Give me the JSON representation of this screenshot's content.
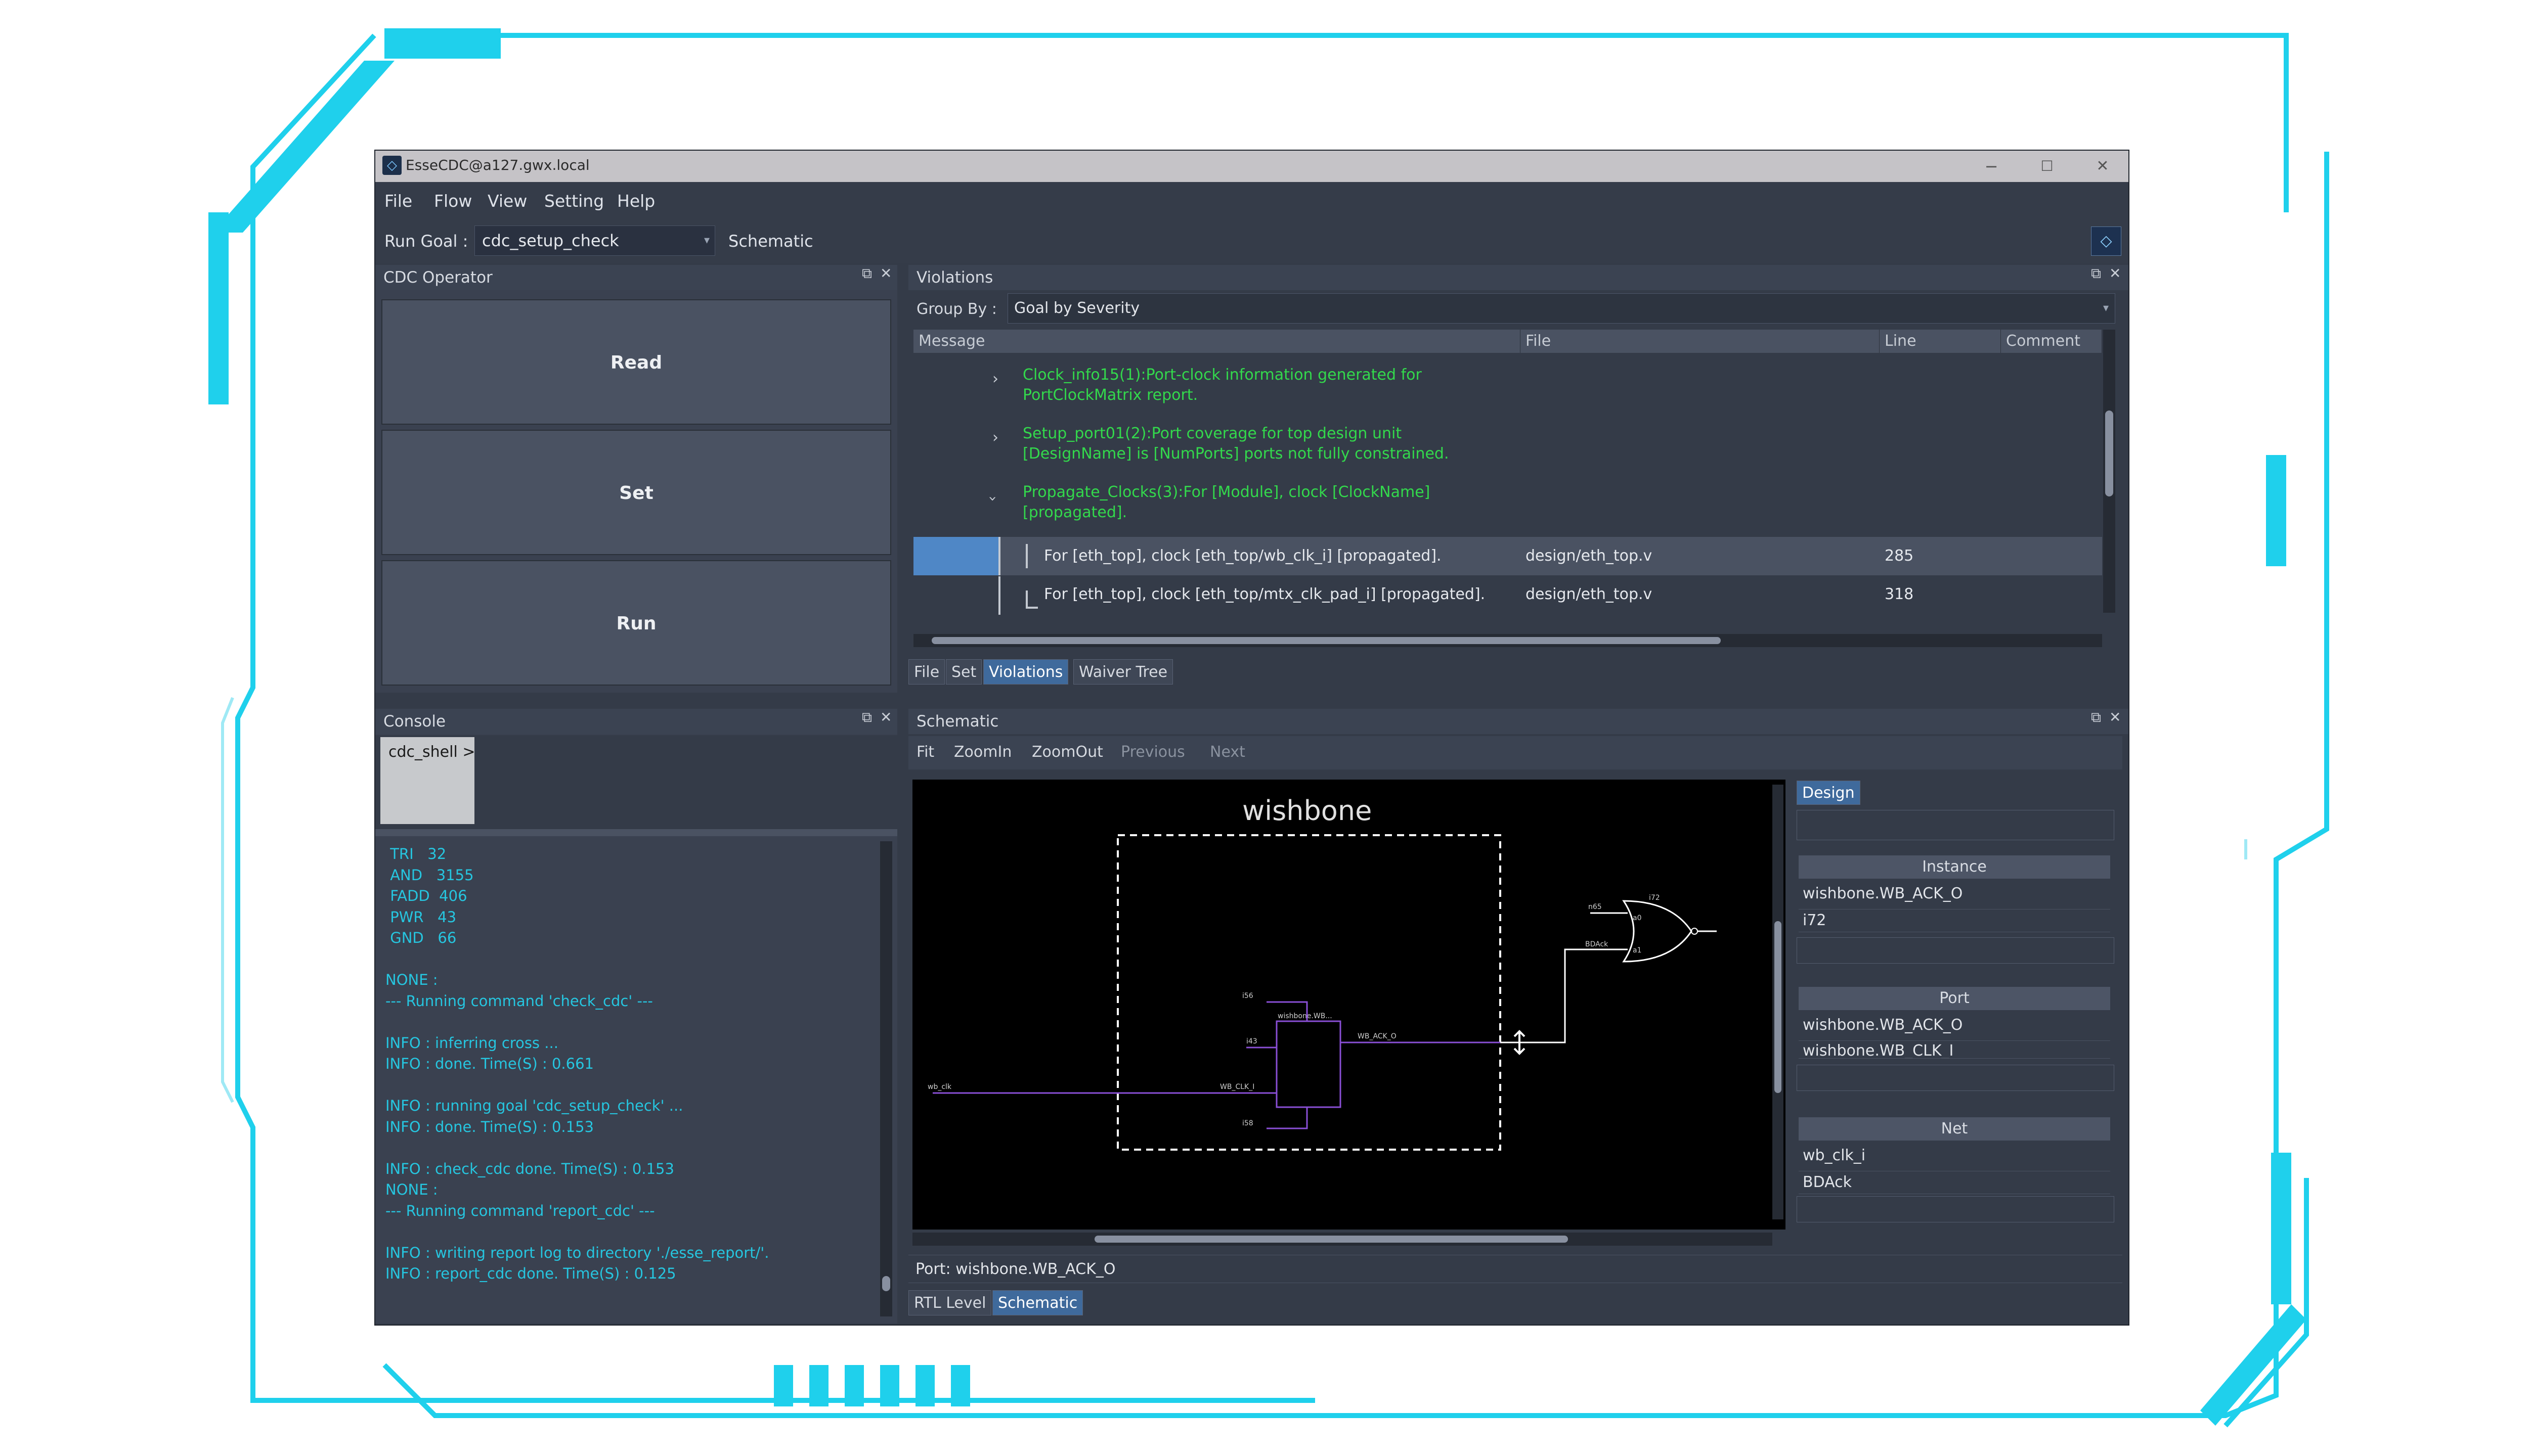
{
  "window": {
    "title": "EsseCDC@a127.gwx.local",
    "minimize_glyph": "−",
    "maximize_glyph": "☐",
    "close_glyph": "✕"
  },
  "menu": [
    {
      "label": "File"
    },
    {
      "label": "Flow"
    },
    {
      "label": "View"
    },
    {
      "label": "Setting"
    },
    {
      "label": "Help"
    }
  ],
  "run_goal": {
    "label": "Run Goal :",
    "value": "cdc_setup_check",
    "schematic_label": "Schematic"
  },
  "cdc_operator": {
    "title": "CDC Operator",
    "buttons": [
      "Read",
      "Set",
      "Run"
    ]
  },
  "violations": {
    "title": "Violations",
    "group_by_label": "Group By :",
    "group_by_value": "Goal by Severity",
    "columns": [
      "Message",
      "File",
      "Line",
      "Comment"
    ],
    "groups": [
      {
        "expanded": false,
        "line1": "Clock_info15(1):Port-clock information generated for",
        "line2": "PortClockMatrix report."
      },
      {
        "expanded": false,
        "line1": "Setup_port01(2):Port coverage for top design unit",
        "line2": "[DesignName] is [NumPorts] ports not fully constrained."
      },
      {
        "expanded": true,
        "line1": "Propagate_Clocks(3):For [Module], clock [ClockName]",
        "line2": "[propagated]."
      }
    ],
    "rows": [
      {
        "message": "For [eth_top], clock [eth_top/wb_clk_i] [propagated].",
        "file": "design/eth_top.v",
        "line": "285",
        "selected": true
      },
      {
        "message": "For [eth_top], clock [eth_top/mtx_clk_pad_i] [propagated].",
        "file": "design/eth_top.v",
        "line": "318",
        "selected": false
      }
    ],
    "tabs": [
      {
        "label": "File",
        "active": false
      },
      {
        "label": "Set",
        "active": false
      },
      {
        "label": "Violations",
        "active": true
      },
      {
        "label": "Waiver Tree",
        "active": false
      }
    ]
  },
  "console": {
    "title": "Console",
    "prompt": "cdc_shell >",
    "lines": [
      " TRI   32",
      " AND   3155",
      " FADD  406",
      " PWR   43",
      " GND   66",
      "",
      "NONE :",
      "--- Running command 'check_cdc' ---",
      "",
      "INFO : inferring cross ...",
      "INFO : done. Time(S) : 0.661",
      "",
      "INFO : running goal 'cdc_setup_check' ...",
      "INFO : done. Time(S) : 0.153",
      "",
      "INFO : check_cdc done. Time(S) : 0.153",
      "NONE :",
      "--- Running command 'report_cdc' ---",
      "",
      "INFO : writing report log to directory './esse_report/'.",
      "INFO : report_cdc done. Time(S) : 0.125"
    ]
  },
  "schematic": {
    "title": "Schematic",
    "toolbar": [
      {
        "label": "Fit",
        "enabled": true
      },
      {
        "label": "ZoomIn",
        "enabled": true
      },
      {
        "label": "ZoomOut",
        "enabled": true
      },
      {
        "label": "Previous",
        "enabled": false
      },
      {
        "label": "Next",
        "enabled": false
      }
    ],
    "module_label": "wishbone",
    "pin_labels": {
      "inst": "wishbone.WB...",
      "ack": "WB_ACK_O",
      "clk": "WB_CLK_I",
      "clk_net": "wb_clk",
      "top_net": "i56",
      "mid_net": "i43",
      "bottom_net": "i58",
      "gate_in1": "n65",
      "gate_in2": "BDAck",
      "gate_a0": "a0",
      "gate_a1": "a1",
      "gate_name": "i72"
    },
    "design_tab": "Design",
    "instance": {
      "header": "Instance",
      "items": [
        "wishbone.WB_ACK_O",
        "i72"
      ]
    },
    "port": {
      "header": "Port",
      "items": [
        "wishbone.WB_ACK_O",
        "wishbone.WB_CLK_I"
      ]
    },
    "net": {
      "header": "Net",
      "items": [
        "wb_clk_i",
        "BDAck"
      ]
    },
    "status": "Port: wishbone.WB_ACK_O",
    "bottom_tabs": [
      {
        "label": "RTL Level",
        "active": false
      },
      {
        "label": "Schematic",
        "active": true
      }
    ]
  },
  "colors": {
    "frame_accent": "#1fd0ec",
    "message_green": "#33d94c",
    "console_cyan": "#26c6e0",
    "selection_blue": "#4f87c6",
    "schematic_net": "#8a4fd6"
  }
}
